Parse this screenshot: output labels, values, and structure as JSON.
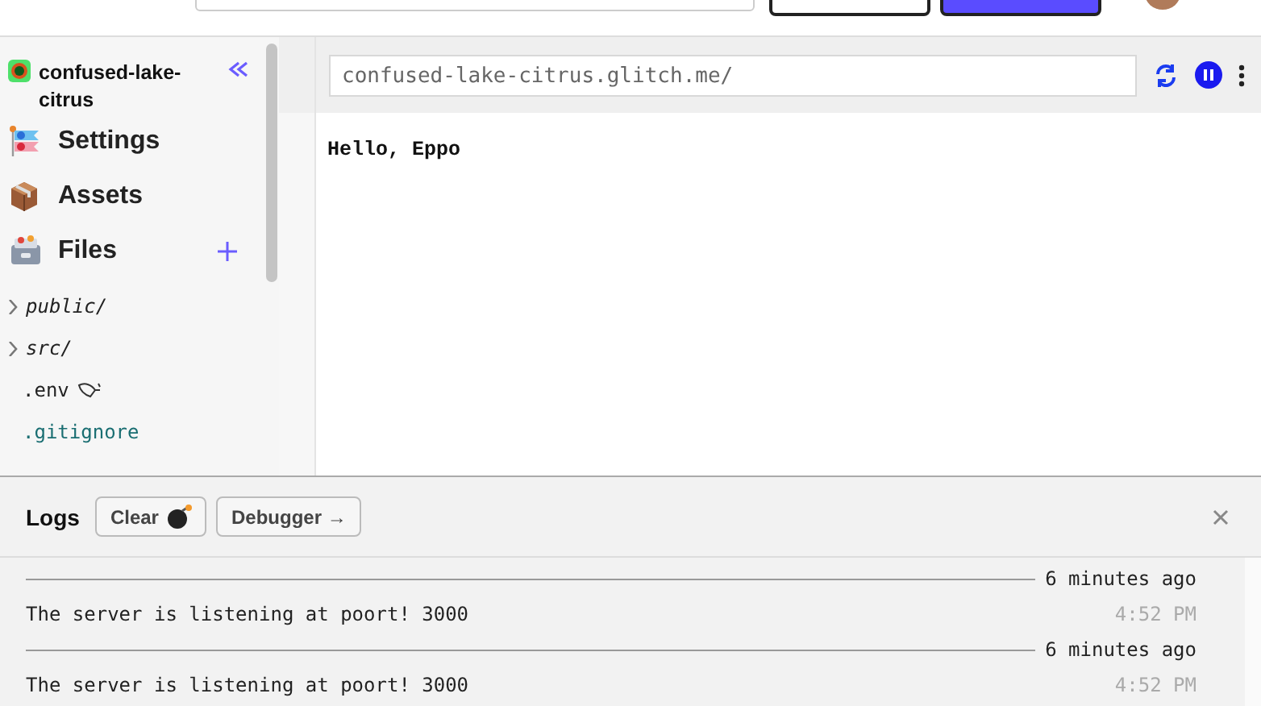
{
  "project": {
    "name": "confused-lake-citrus"
  },
  "nav": [
    {
      "label": "Settings",
      "kind": "settings"
    },
    {
      "label": "Assets",
      "kind": "assets"
    },
    {
      "label": "Files",
      "kind": "files"
    }
  ],
  "files": [
    {
      "name": "public/",
      "kind": "folder",
      "expanded": false
    },
    {
      "name": "src/",
      "kind": "folder",
      "expanded": false
    },
    {
      "name": ".env",
      "kind": "env"
    },
    {
      "name": ".gitignore",
      "kind": "ignored"
    }
  ],
  "preview": {
    "url": "confused-lake-citrus.glitch.me/",
    "body": "Hello, Eppo"
  },
  "logs": {
    "title": "Logs",
    "buttons": [
      {
        "label": "Clear",
        "kind": "clear"
      },
      {
        "label": "Debugger",
        "kind": "debugger",
        "arrow": "→"
      }
    ],
    "entries": [
      {
        "kind": "divider",
        "text": "6 minutes ago"
      },
      {
        "kind": "message",
        "text": "The server is listening at poort! 3000",
        "time": "4:52 PM"
      },
      {
        "kind": "divider",
        "text": "6 minutes ago"
      },
      {
        "kind": "message",
        "text": "The server is listening at poort! 3000",
        "time": "4:52 PM"
      }
    ]
  }
}
